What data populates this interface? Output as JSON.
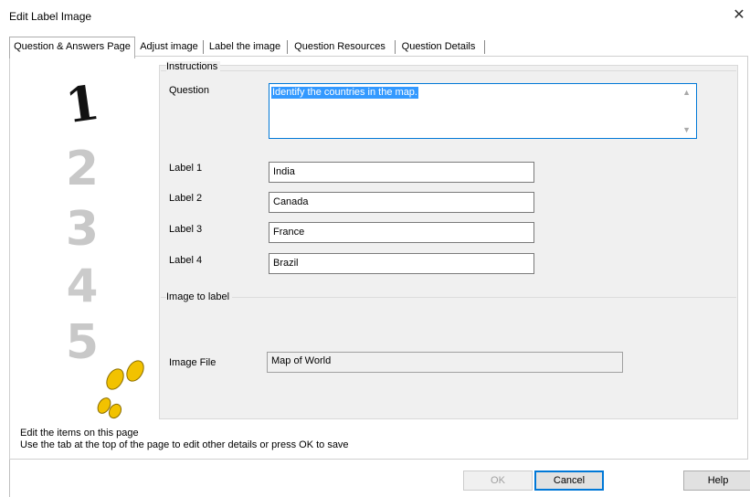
{
  "window": {
    "title": "Edit Label Image",
    "close_glyph": "✕"
  },
  "tabs": [
    {
      "label": "Question & Answers Page",
      "active": true
    },
    {
      "label": "Adjust image"
    },
    {
      "label": "Label the image"
    },
    {
      "label": "Question Resources"
    },
    {
      "label": "Question Details"
    }
  ],
  "instructions": {
    "legend": "Instructions",
    "question_label": "Question",
    "question_value": "Identify the countries in the map.",
    "labels": [
      {
        "label": "Label 1",
        "value": "India"
      },
      {
        "label": "Label 2",
        "value": "Canada"
      },
      {
        "label": "Label 3",
        "value": "France"
      },
      {
        "label": "Label 4",
        "value": "Brazil"
      }
    ]
  },
  "image_group": {
    "legend": "Image to label",
    "file_label": "Image File",
    "file_value": "Map of World"
  },
  "side_image": {
    "steps": [
      "1",
      "2",
      "3",
      "4",
      "5"
    ],
    "icon": "footprints-icon"
  },
  "status": {
    "line1": "Edit the items on this page",
    "line2": "Use the tab at the top of the page to edit other details or press OK to save"
  },
  "buttons": {
    "ok": "OK",
    "cancel": "Cancel",
    "help": "Help"
  },
  "colors": {
    "accent": "#0078d7",
    "selection": "#3399ff",
    "panel": "#f0f0f0",
    "footprint": "#f2c200"
  }
}
